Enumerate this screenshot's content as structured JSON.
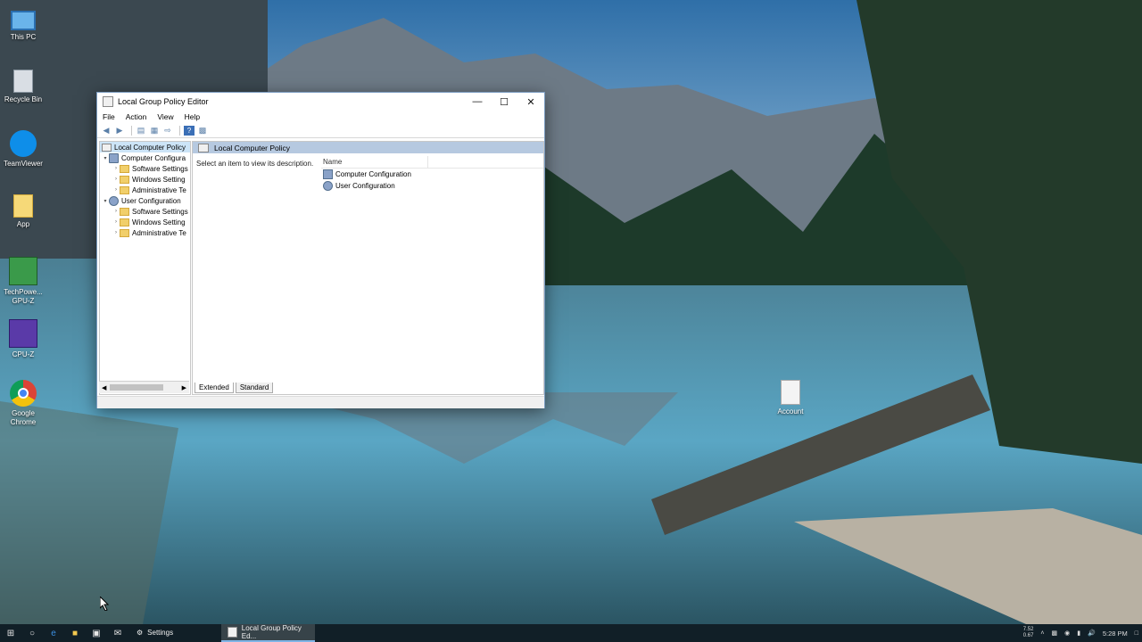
{
  "desktop": {
    "icons": [
      {
        "label": "This PC",
        "icon": "pc-icon"
      },
      {
        "label": "Recycle Bin",
        "icon": "recycle-bin-icon"
      },
      {
        "label": "TeamViewer",
        "icon": "teamviewer-icon"
      },
      {
        "label": "App",
        "icon": "folder-icon"
      },
      {
        "label": "TechPowe... GPU-Z",
        "icon": "gpuz-icon"
      },
      {
        "label": "CPU-Z",
        "icon": "cpuz-icon"
      },
      {
        "label": "Google Chrome",
        "icon": "chrome-icon"
      },
      {
        "label": "Account",
        "icon": "document-icon"
      }
    ]
  },
  "window": {
    "title": "Local Group Policy Editor",
    "menu": [
      "File",
      "Action",
      "View",
      "Help"
    ],
    "tree": [
      {
        "label": "Local Computer Policy",
        "level": 0,
        "expander": "",
        "icon": "policy",
        "selected": true
      },
      {
        "label": "Computer Configura",
        "level": 1,
        "expander": "▾",
        "icon": "computer"
      },
      {
        "label": "Software Settings",
        "level": 2,
        "expander": "›",
        "icon": "folder"
      },
      {
        "label": "Windows Setting",
        "level": 2,
        "expander": "›",
        "icon": "folder"
      },
      {
        "label": "Administrative Te",
        "level": 2,
        "expander": "›",
        "icon": "folder"
      },
      {
        "label": "User Configuration",
        "level": 1,
        "expander": "▾",
        "icon": "user"
      },
      {
        "label": "Software Settings",
        "level": 2,
        "expander": "›",
        "icon": "folder"
      },
      {
        "label": "Windows Setting",
        "level": 2,
        "expander": "›",
        "icon": "folder"
      },
      {
        "label": "Administrative Te",
        "level": 2,
        "expander": "›",
        "icon": "folder"
      }
    ],
    "right_header": "Local Computer Policy",
    "description": "Select an item to view its description.",
    "list_header": "Name",
    "list_items": [
      "Computer Configuration",
      "User Configuration"
    ],
    "tabs": [
      "Extended",
      "Standard"
    ]
  },
  "taskbar": {
    "apps": [
      {
        "label": "Settings",
        "active": false
      },
      {
        "label": "Local Group Policy Ed...",
        "active": true
      }
    ],
    "tray_small": "7.52\n0.67",
    "clock": "5:28 PM"
  }
}
